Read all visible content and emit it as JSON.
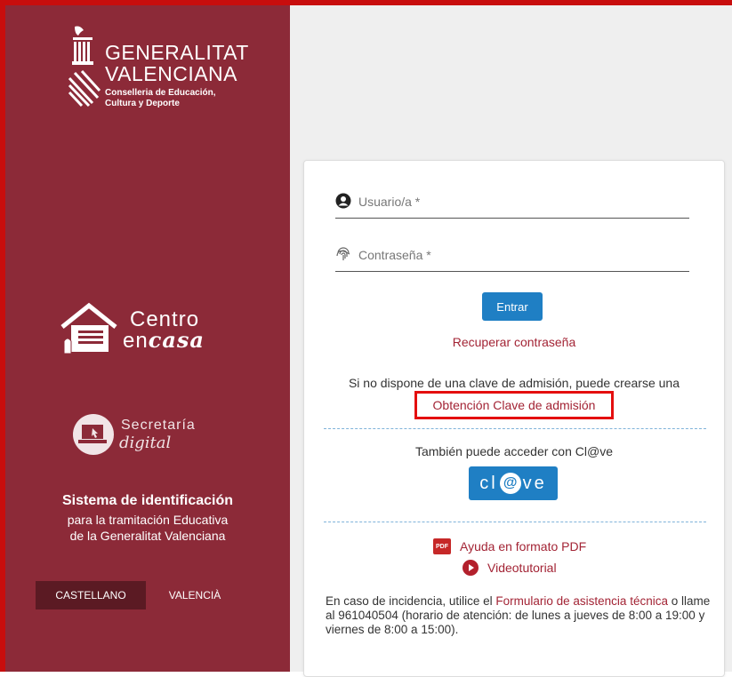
{
  "brand": {
    "name_line1": "GENERALITAT",
    "name_line2": "VALENCIANA",
    "conselleria_line1": "Conselleria de Educación,",
    "conselleria_line2": "Cultura y Deporte",
    "centro_line1": "Centro",
    "centro_line2_a": "en",
    "centro_line2_b": "casa",
    "secretaria_line1": "Secretaría",
    "secretaria_line2": "digital",
    "system_title": "Sistema de identificación",
    "system_sub1": "para la tramitación Educativa",
    "system_sub2": "de la Generalitat Valenciana"
  },
  "languages": [
    {
      "label": "CASTELLANO",
      "active": true
    },
    {
      "label": "VALENCIÀ",
      "active": false
    }
  ],
  "form": {
    "username_placeholder": "Usuario/a *",
    "password_placeholder": "Contraseña *",
    "submit_label": "Entrar",
    "recover_link": "Recuperar contraseña",
    "no_key_text": "Si no dispone de una clave de admisión, puede crearse una",
    "obtain_key_link": "Obtención Clave de admisión",
    "clave_text": "También puede acceder con Cl@ve",
    "clave_button_a": "cl",
    "clave_button_at": "@",
    "clave_button_b": "ve"
  },
  "help": {
    "pdf_icon": "PDF",
    "pdf_link": "Ayuda en formato PDF",
    "video_link": "Videotutorial",
    "incidence_prefix": "En caso de incidencia, utilice el ",
    "incidence_link": "Formulario de asistencia técnica",
    "incidence_suffix": " o llame al 961040504 (horario de atención: de lunes a jueves de 8:00 a 19:00 y viernes de 8:00 a 15:00)."
  },
  "colors": {
    "sidebar_bg": "#8c2a38",
    "accent_blue": "#1f7fc4",
    "link_red": "#a32435",
    "highlight_box": "#e40f0f"
  }
}
